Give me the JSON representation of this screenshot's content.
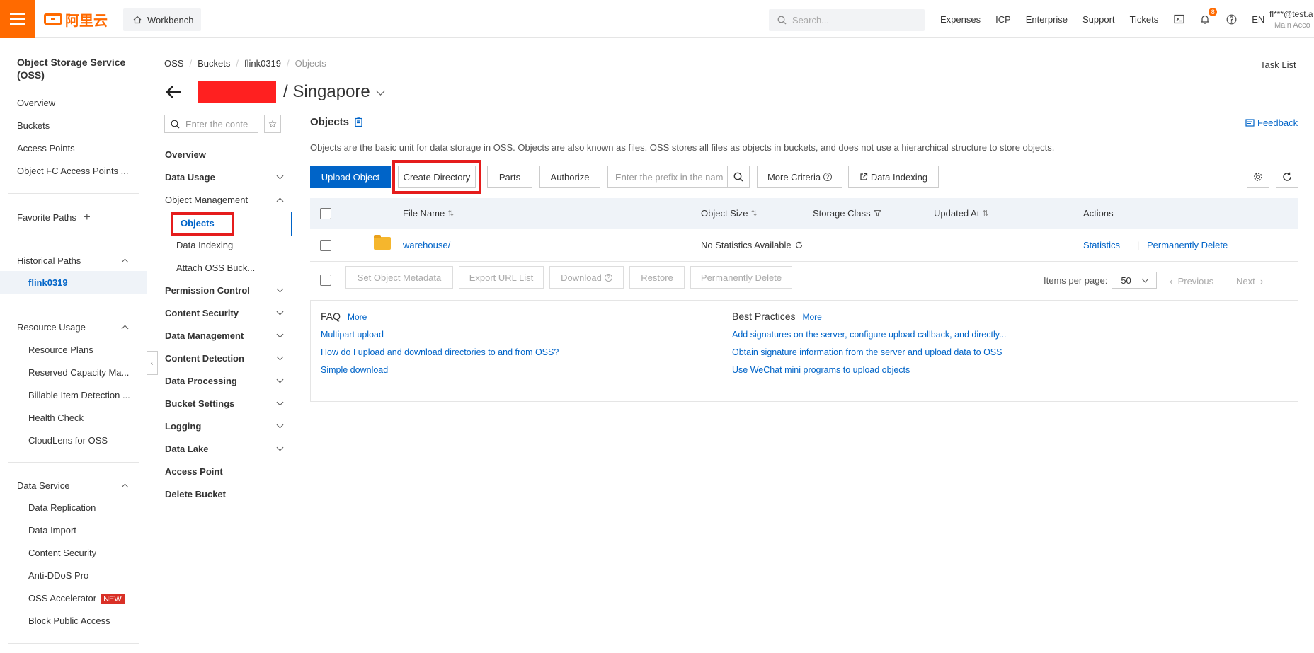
{
  "topbar": {
    "logo_text": "阿里云",
    "workbench": "Workbench",
    "search_placeholder": "Search...",
    "links": [
      "Expenses",
      "ICP",
      "Enterprise",
      "Support",
      "Tickets"
    ],
    "notification_count": "8",
    "lang": "EN",
    "user_name": "fl***@test.a",
    "user_role": "Main Acco"
  },
  "sidebar": {
    "title": "Object Storage Service (OSS)",
    "items": [
      "Overview",
      "Buckets",
      "Access Points",
      "Object FC Access Points ..."
    ],
    "favorite_paths": "Favorite Paths",
    "historical_paths": "Historical Paths",
    "historical_active": "flink0319",
    "resource_usage": "Resource Usage",
    "resource_items": [
      "Resource Plans",
      "Reserved Capacity Ma...",
      "Billable Item Detection ...",
      "Health Check",
      "CloudLens for OSS"
    ],
    "data_service": "Data Service",
    "data_service_items": [
      "Data Replication",
      "Data Import",
      "Content Security",
      "Anti-DDoS Pro",
      "OSS Accelerator",
      "Block Public Access"
    ],
    "new_badge": "NEW"
  },
  "breadcrumb": [
    "OSS",
    "Buckets",
    "flink0319",
    "Objects"
  ],
  "task_list": "Task List",
  "bucket_title": "/ Singapore",
  "midnav": {
    "search_placeholder": "Enter the conte",
    "overview": "Overview",
    "data_usage": "Data Usage",
    "object_management": "Object Management",
    "objects": "Objects",
    "data_indexing": "Data Indexing",
    "attach": "Attach OSS Buck...",
    "groups": [
      "Permission Control",
      "Content Security",
      "Data Management",
      "Content Detection",
      "Data Processing",
      "Bucket Settings",
      "Logging",
      "Data Lake"
    ],
    "access_point": "Access Point",
    "delete_bucket": "Delete Bucket"
  },
  "main": {
    "section_title": "Objects",
    "feedback": "Feedback",
    "description": "Objects are the basic unit for data storage in OSS. Objects are also known as files. OSS stores all files as objects in buckets, and does not use a hierarchical structure to store objects.",
    "buttons": {
      "upload": "Upload Object",
      "create_dir": "Create Directory",
      "parts": "Parts",
      "authorize": "Authorize",
      "prefix_placeholder": "Enter the prefix in the nam",
      "more_criteria": "More Criteria",
      "data_indexing": "Data Indexing"
    },
    "columns": [
      "File Name",
      "Object Size",
      "Storage Class",
      "Updated At",
      "Actions"
    ],
    "rows": [
      {
        "name": "warehouse/",
        "size": "No Statistics Available",
        "action1": "Statistics",
        "action2": "Permanently Delete"
      }
    ],
    "bulk": [
      "Set Object Metadata",
      "Export URL List",
      "Download",
      "Restore",
      "Permanently Delete"
    ],
    "items_per_page_label": "Items per page:",
    "items_per_page": "50",
    "previous": "Previous",
    "next": "Next"
  },
  "faq": {
    "title": "FAQ",
    "more": "More",
    "links": [
      "Multipart upload",
      "How do I upload and download directories to and from OSS?",
      "Simple download"
    ]
  },
  "best_practices": {
    "title": "Best Practices",
    "more": "More",
    "links": [
      "Add signatures on the server, configure upload callback, and directly...",
      "Obtain signature information from the server and upload data to OSS",
      "Use WeChat mini programs to upload objects"
    ]
  },
  "colors": {
    "brand": "#ff6a00",
    "link": "#0064c8",
    "highlight": "#e51c1c"
  }
}
